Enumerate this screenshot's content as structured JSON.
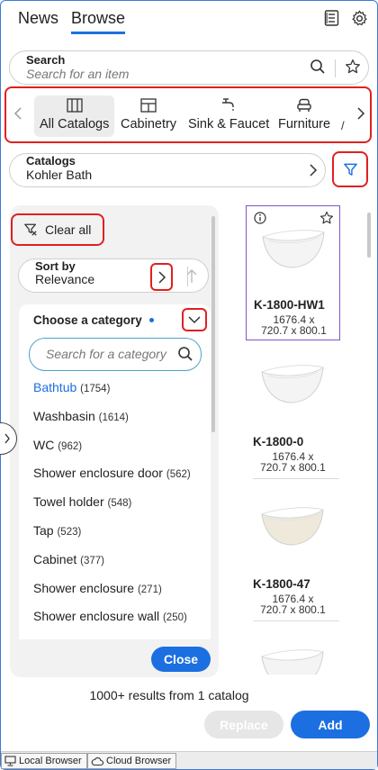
{
  "header": {
    "tabs": [
      {
        "label": "News",
        "active": false
      },
      {
        "label": "Browse",
        "active": true
      }
    ],
    "icons": [
      "list-icon",
      "gear-icon"
    ]
  },
  "search": {
    "label": "Search",
    "placeholder": "Search for an item"
  },
  "categories": {
    "items": [
      {
        "label": "All Catalogs",
        "icon": "book-icon",
        "selected": true
      },
      {
        "label": "Cabinetry",
        "icon": "cabinet-icon",
        "selected": false
      },
      {
        "label": "Sink & Faucet",
        "icon": "faucet-icon",
        "selected": false
      },
      {
        "label": "Furniture",
        "icon": "armchair-icon",
        "selected": false
      }
    ]
  },
  "catalogs": {
    "label": "Catalogs",
    "value": "Kohler Bath"
  },
  "filter_panel": {
    "clear_all": "Clear all",
    "sort": {
      "label": "Sort by",
      "value": "Relevance"
    },
    "category_title": "Choose a category",
    "category_search_placeholder": "Search for a category",
    "categories": [
      {
        "name": "Bathtub",
        "count": "(1754)",
        "active": true
      },
      {
        "name": "Washbasin",
        "count": "(1614)",
        "active": false
      },
      {
        "name": "WC",
        "count": "(962)",
        "active": false
      },
      {
        "name": "Shower enclosure door",
        "count": "(562)",
        "active": false
      },
      {
        "name": "Towel holder",
        "count": "(548)",
        "active": false
      },
      {
        "name": "Tap",
        "count": "(523)",
        "active": false
      },
      {
        "name": "Cabinet",
        "count": "(377)",
        "active": false
      },
      {
        "name": "Shower enclosure",
        "count": "(271)",
        "active": false
      },
      {
        "name": "Shower enclosure wall",
        "count": "(250)",
        "active": false
      }
    ],
    "close": "Close"
  },
  "products": [
    {
      "name": "K-1800-HW1",
      "dim1": "1676.4 x",
      "dim2": "720.7 x  800.1",
      "color": "#f4f4f4",
      "selected": true
    },
    {
      "name": "K-1800-0",
      "dim1": "1676.4 x",
      "dim2": "720.7 x  800.1",
      "color": "#f4f4f4",
      "selected": false
    },
    {
      "name": "K-1800-47",
      "dim1": "1676.4 x",
      "dim2": "720.7 x  800.1",
      "color": "#efe9dc",
      "selected": false
    }
  ],
  "results_text": "1000+ results from 1 catalog",
  "actions": {
    "replace": "Replace",
    "add": "Add"
  },
  "bottom_tabs": [
    "Local Browser",
    "Cloud Browser"
  ],
  "colors": {
    "accent": "#1c6fe0",
    "highlight": "#e02020",
    "selection": "#7e57c2"
  }
}
